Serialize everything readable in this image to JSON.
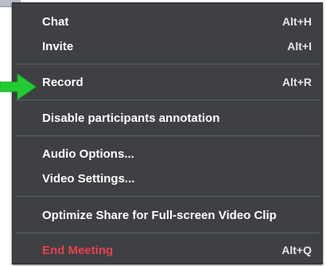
{
  "menu": {
    "items": [
      {
        "label": "Chat",
        "shortcut": "Alt+H"
      },
      {
        "label": "Invite",
        "shortcut": "Alt+I"
      },
      {
        "label": "Record",
        "shortcut": "Alt+R"
      },
      {
        "label": "Disable participants annotation",
        "shortcut": ""
      },
      {
        "label": "Audio Options...",
        "shortcut": ""
      },
      {
        "label": "Video Settings...",
        "shortcut": ""
      },
      {
        "label": "Optimize Share for Full-screen Video Clip",
        "shortcut": ""
      },
      {
        "label": "End Meeting",
        "shortcut": "Alt+Q"
      }
    ]
  },
  "colors": {
    "menu_background": "#3e4043",
    "menu_text": "#ffffff",
    "separator": "#5d6064",
    "danger_text": "#e8414c",
    "arrow": "#22cc33"
  },
  "icons": {
    "pointer": "green-arrow-icon"
  }
}
